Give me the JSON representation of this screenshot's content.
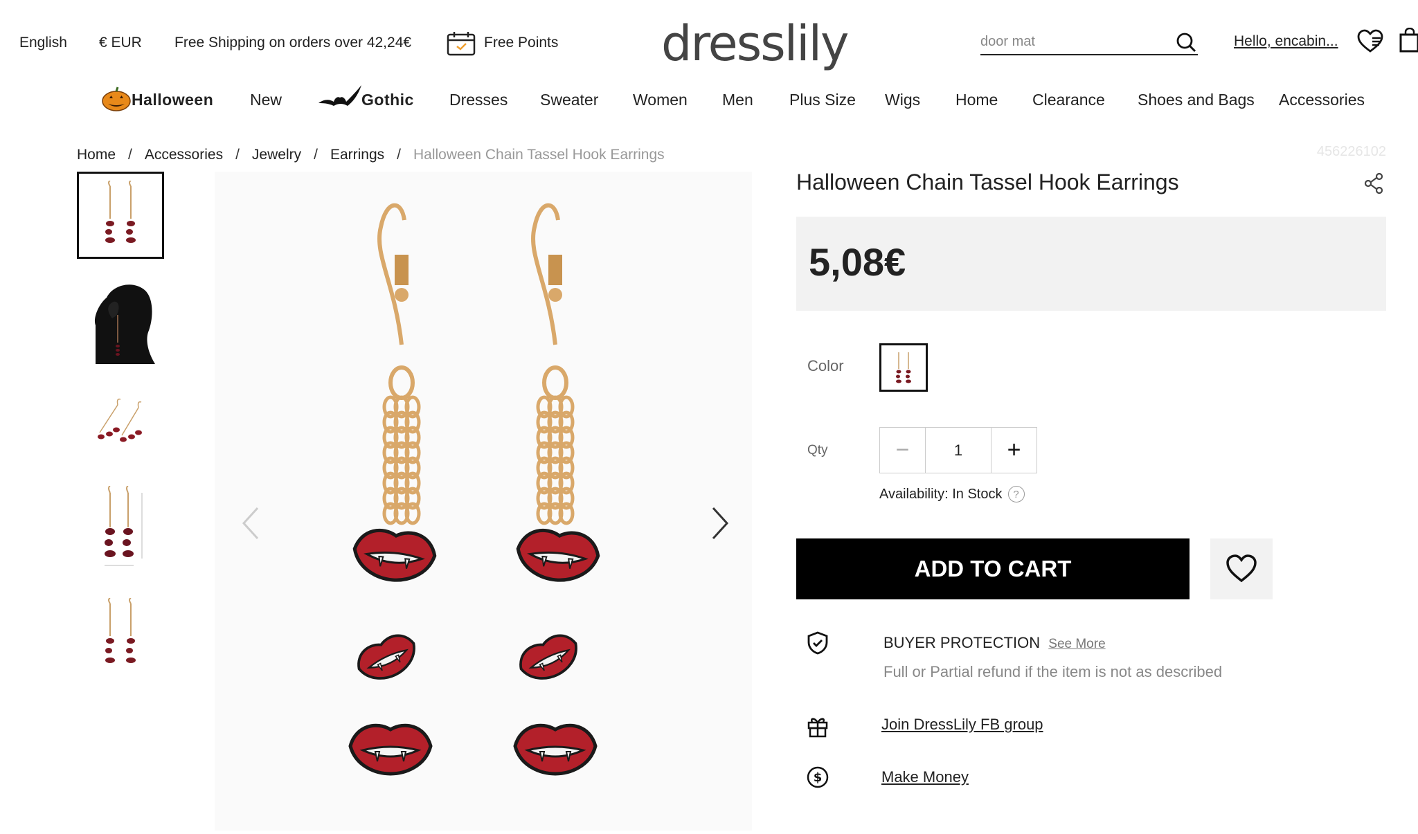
{
  "topbar": {
    "language": "English",
    "currency": "€ EUR",
    "shipping": "Free Shipping on orders over 42,24€",
    "points": "Free Points",
    "logo": "dresslily",
    "search_placeholder": "door mat",
    "greeting": "Hello, encabin..."
  },
  "nav": {
    "items": [
      "Halloween",
      "New",
      "Gothic",
      "Dresses",
      "Sweater",
      "Women",
      "Men",
      "Plus Size",
      "Wigs",
      "Home",
      "Clearance",
      "Shoes and Bags",
      "Accessories"
    ]
  },
  "breadcrumb": {
    "items": [
      "Home",
      "Accessories",
      "Jewelry",
      "Earrings"
    ],
    "separator": "/",
    "current": "Halloween Chain Tassel Hook Earrings"
  },
  "sku": "456226102",
  "product": {
    "title": "Halloween Chain Tassel Hook Earrings",
    "price": "5,08€",
    "color_label": "Color",
    "qty_label": "Qty",
    "qty_value": "1",
    "qty_minus": "−",
    "qty_plus": "+",
    "availability": "Availability: In Stock",
    "help_glyph": "?",
    "add_to_cart": "ADD TO CART"
  },
  "protection": {
    "title": "BUYER PROTECTION",
    "see_more": "See More",
    "desc": "Full or Partial refund if the item is not as described"
  },
  "links": {
    "fb_group": "Join DressLily FB group",
    "make_money": "Make Money"
  },
  "colors": {
    "accent_black": "#000000",
    "lip_red": "#b3202a",
    "gold": "#d9a86a",
    "price_bg": "#f2f2f2"
  }
}
